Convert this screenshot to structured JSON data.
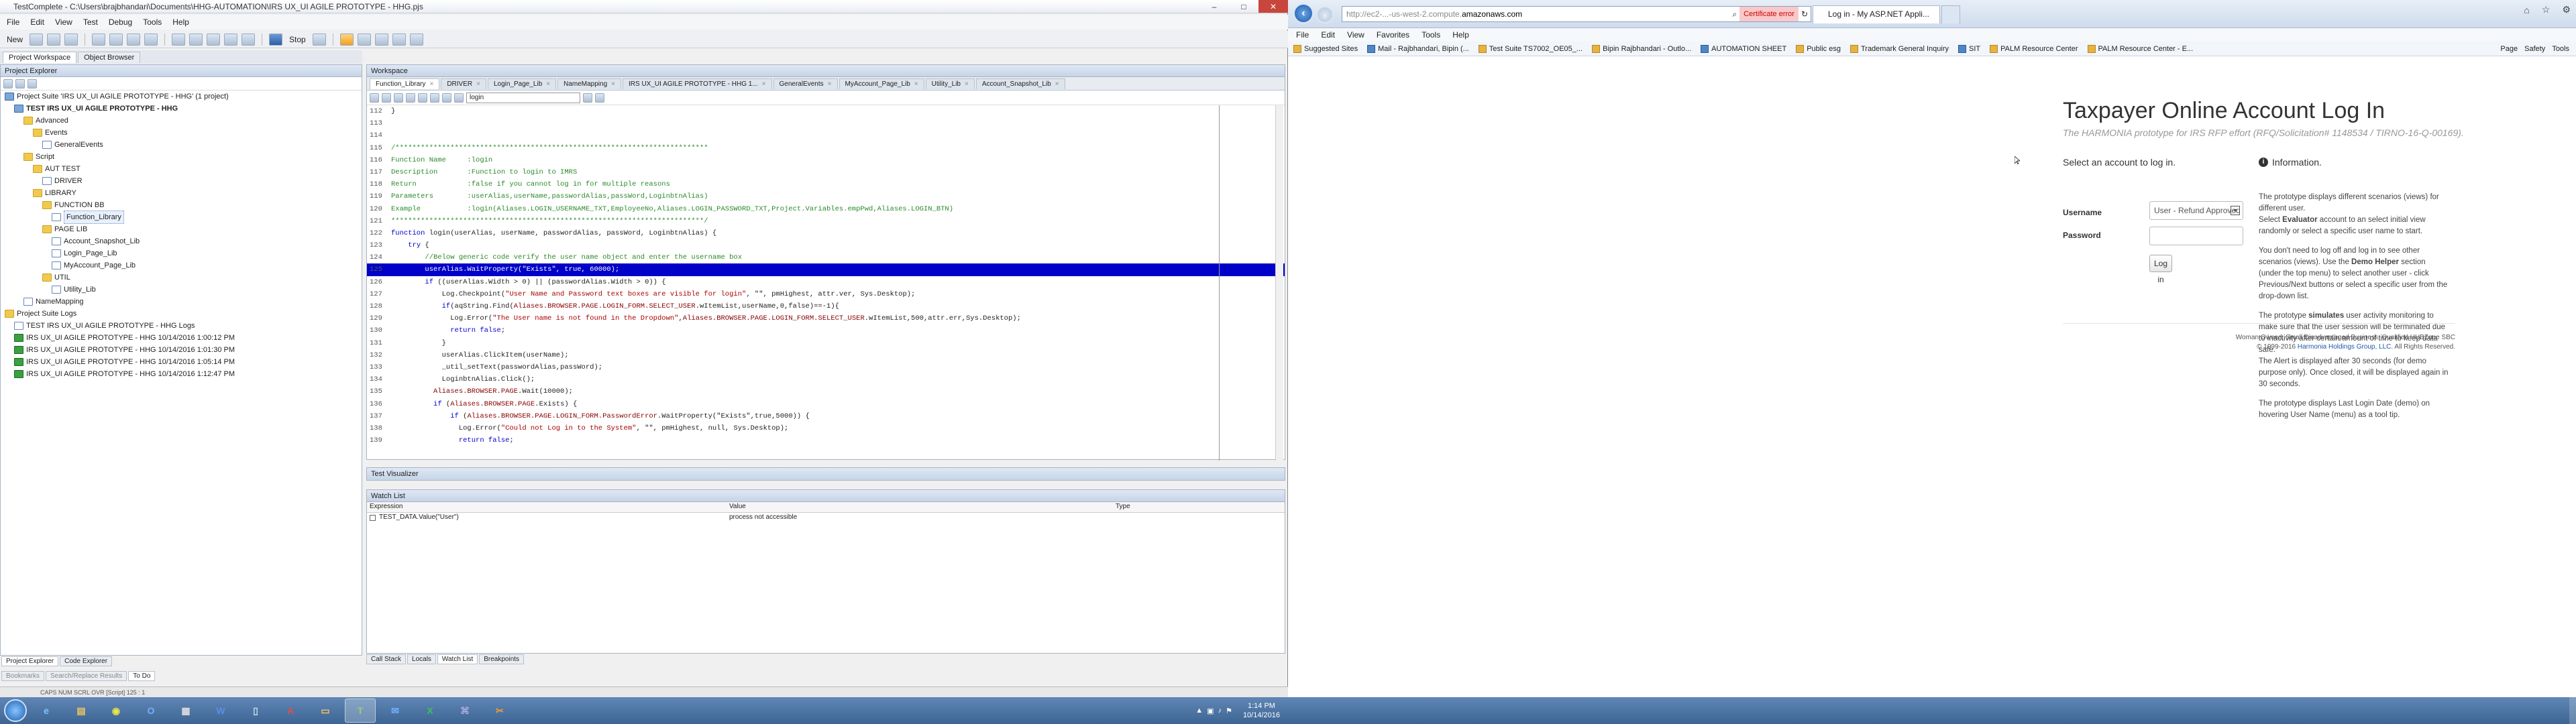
{
  "testcomplete": {
    "title": "TestComplete - C:\\Users\\brajbhandari\\Documents\\HHG-AUTOMATION\\IRS UX_UI AGILE PROTOTYPE - HHG.pjs",
    "window_controls": [
      "–",
      "□",
      "✕"
    ],
    "menu": [
      "File",
      "Edit",
      "View",
      "Test",
      "Debug",
      "Tools",
      "Help"
    ],
    "toolbar": {
      "new_label": "New",
      "stop_label": "Stop"
    },
    "left_tabs": [
      "Project Workspace",
      "Object Browser"
    ],
    "project_explorer": {
      "title": "Project Explorer",
      "items": [
        {
          "indent": 0,
          "icon": "proj",
          "label": "Project Suite 'IRS UX_UI AGILE PROTOTYPE - HHG' (1 project)"
        },
        {
          "indent": 1,
          "icon": "proj",
          "label": "TEST IRS UX_UI AGILE PROTOTYPE - HHG",
          "bold": true
        },
        {
          "indent": 2,
          "icon": "folder",
          "label": "Advanced"
        },
        {
          "indent": 3,
          "icon": "folder",
          "label": "Events"
        },
        {
          "indent": 4,
          "icon": "file",
          "label": "GeneralEvents"
        },
        {
          "indent": 2,
          "icon": "folder",
          "label": "Script"
        },
        {
          "indent": 3,
          "icon": "folder",
          "label": "AUT TEST"
        },
        {
          "indent": 4,
          "icon": "file",
          "label": "DRIVER"
        },
        {
          "indent": 3,
          "icon": "folder",
          "label": "LIBRARY"
        },
        {
          "indent": 4,
          "icon": "folder",
          "label": "FUNCTION BB"
        },
        {
          "indent": 5,
          "icon": "file",
          "label": "Function_Library",
          "selected": true
        },
        {
          "indent": 4,
          "icon": "folder",
          "label": "PAGE LIB"
        },
        {
          "indent": 5,
          "icon": "file",
          "label": "Account_Snapshot_Lib"
        },
        {
          "indent": 5,
          "icon": "file",
          "label": "Login_Page_Lib"
        },
        {
          "indent": 5,
          "icon": "file",
          "label": "MyAccount_Page_Lib"
        },
        {
          "indent": 4,
          "icon": "folder",
          "label": "UTIL"
        },
        {
          "indent": 5,
          "icon": "file",
          "label": "Utility_Lib"
        },
        {
          "indent": 2,
          "icon": "file",
          "label": "NameMapping"
        },
        {
          "indent": 0,
          "icon": "folder",
          "label": "Project Suite Logs"
        },
        {
          "indent": 1,
          "icon": "file",
          "label": "TEST IRS UX_UI AGILE PROTOTYPE - HHG Logs"
        },
        {
          "indent": 1,
          "icon": "ok",
          "label": "IRS UX_UI AGILE PROTOTYPE - HHG 10/14/2016 1:00:12 PM"
        },
        {
          "indent": 1,
          "icon": "ok",
          "label": "IRS UX_UI AGILE PROTOTYPE - HHG 10/14/2016 1:01:30 PM"
        },
        {
          "indent": 1,
          "icon": "ok",
          "label": "IRS UX_UI AGILE PROTOTYPE - HHG 10/14/2016 1:05:14 PM"
        },
        {
          "indent": 1,
          "icon": "ok",
          "label": "IRS UX_UI AGILE PROTOTYPE - HHG 10/14/2016 1:12:47 PM"
        }
      ],
      "bottom_tabs": [
        "Project Explorer",
        "Code Explorer"
      ],
      "bottom_tabs2": [
        "Bookmarks",
        "Search/Replace Results",
        "To Do"
      ]
    },
    "workspace": {
      "title": "Workspace",
      "tabs": [
        "Function_Library",
        "DRIVER",
        "Login_Page_Lib",
        "NameMapping",
        "IRS UX_UI AGILE PROTOTYPE - HHG 1...",
        "GeneralEvents",
        "MyAccount_Page_Lib",
        "Utility_Lib",
        "Account_Snapshot_Lib"
      ],
      "routine_combo": "login",
      "code_lines": [
        {
          "n": "112",
          "segs": [
            [
              "",
              "}"
            ]
          ]
        },
        {
          "n": "113",
          "segs": [
            [
              "",
              ""
            ]
          ]
        },
        {
          "n": "114",
          "segs": [
            [
              "",
              ""
            ]
          ]
        },
        {
          "n": "115",
          "segs": [
            [
              "cm",
              "/**************************************************************************"
            ]
          ]
        },
        {
          "n": "116",
          "segs": [
            [
              "cm",
              "Function Name     :login"
            ]
          ]
        },
        {
          "n": "117",
          "segs": [
            [
              "cm",
              "Description       :Function to login to IMRS"
            ]
          ]
        },
        {
          "n": "118",
          "segs": [
            [
              "cm",
              "Return            :false if you cannot log in for multiple reasons"
            ]
          ]
        },
        {
          "n": "119",
          "segs": [
            [
              "cm",
              "Parameters        :userAlias,userName,passwordAlias,passWord,LoginbtnAlias)"
            ]
          ]
        },
        {
          "n": "120",
          "segs": [
            [
              "cm",
              "Example           :login(Aliases.LOGIN_USERNAME_TXT,EmployeeNo,Aliases.LOGIN_PASSWORD_TXT,Project.Variables.empPwd,Aliases.LOGIN_BTN)"
            ]
          ]
        },
        {
          "n": "121",
          "segs": [
            [
              "cm",
              "**************************************************************************/"
            ]
          ]
        },
        {
          "n": "122",
          "segs": [
            [
              "kw",
              "function"
            ],
            [
              "",
              " login(userAlias, userName, passwordAlias, passWord, LoginbtnAlias) {"
            ]
          ]
        },
        {
          "n": "123",
          "segs": [
            [
              "",
              "    "
            ],
            [
              "kw",
              "try"
            ],
            [
              "",
              " {"
            ]
          ]
        },
        {
          "n": "124",
          "segs": [
            [
              "",
              "        "
            ],
            [
              "cm",
              "//Below generic code verify the user name object and enter the username box"
            ]
          ]
        },
        {
          "n": "125",
          "hl": true,
          "segs": [
            [
              "",
              "        userAlias.WaitProperty(\"Exists\", true, 60000);"
            ]
          ]
        },
        {
          "n": "126",
          "segs": [
            [
              "",
              "        "
            ],
            [
              "kw",
              "if"
            ],
            [
              "",
              " ((userAlias.Width > 0) || (passwordAlias.Width > 0)) {"
            ]
          ]
        },
        {
          "n": "127",
          "segs": [
            [
              "",
              "            Log.Checkpoint("
            ],
            [
              "str",
              "\"User Name and Password text boxes are visible for login\""
            ],
            [
              "",
              ", \"\", pmHighest, attr.ver, Sys.Desktop);"
            ]
          ]
        },
        {
          "n": "128",
          "segs": [
            [
              "",
              "            "
            ],
            [
              "kw",
              "if"
            ],
            [
              "",
              "(aqString.Find("
            ],
            [
              "obj",
              "Aliases.BROWSER.PAGE.LOGIN_FORM.SELECT_USER"
            ],
            [
              "",
              ".wItemList,userName,0,false)==-1){"
            ]
          ]
        },
        {
          "n": "129",
          "segs": [
            [
              "",
              "              Log.Error("
            ],
            [
              "str",
              "\"The User name is not found in the Dropdown\""
            ],
            [
              "",
              ","
            ],
            [
              "obj",
              "Aliases.BROWSER.PAGE.LOGIN_FORM.SELECT_USER"
            ],
            [
              "",
              ".wItemList,500,attr.err,Sys.Desktop);"
            ]
          ]
        },
        {
          "n": "130",
          "segs": [
            [
              "",
              "              "
            ],
            [
              "kw",
              "return false"
            ],
            [
              "",
              ";"
            ]
          ]
        },
        {
          "n": "131",
          "segs": [
            [
              "",
              "            }"
            ]
          ]
        },
        {
          "n": "132",
          "segs": [
            [
              "",
              "            userAlias.ClickItem(userName);"
            ]
          ]
        },
        {
          "n": "133",
          "segs": [
            [
              "",
              "            _util_setText(passwordAlias,passWord);"
            ]
          ]
        },
        {
          "n": "134",
          "segs": [
            [
              "",
              "            LoginbtnAlias.Click();"
            ]
          ]
        },
        {
          "n": "135",
          "segs": [
            [
              "",
              "          "
            ],
            [
              "obj",
              "Aliases.BROWSER.PAGE"
            ],
            [
              "",
              ".Wait(10000);"
            ]
          ]
        },
        {
          "n": "136",
          "segs": [
            [
              "",
              "          "
            ],
            [
              "kw",
              "if"
            ],
            [
              "",
              " ("
            ],
            [
              "obj",
              "Aliases.BROWSER.PAGE"
            ],
            [
              "",
              ".Exists) {"
            ]
          ]
        },
        {
          "n": "137",
          "segs": [
            [
              "",
              "              "
            ],
            [
              "kw",
              "if"
            ],
            [
              "",
              " ("
            ],
            [
              "obj",
              "Aliases.BROWSER.PAGE.LOGIN_FORM.PasswordError"
            ],
            [
              "",
              ".WaitProperty(\"Exists\",true,5000)) {"
            ]
          ]
        },
        {
          "n": "138",
          "segs": [
            [
              "",
              "                Log.Error("
            ],
            [
              "str",
              "\"Could not Log in to the System\""
            ],
            [
              "",
              ", \"\", pmHighest, null, Sys.Desktop);"
            ]
          ]
        },
        {
          "n": "139",
          "segs": [
            [
              "",
              "                "
            ],
            [
              "kw",
              "return false"
            ],
            [
              "",
              ";"
            ]
          ]
        }
      ]
    },
    "test_visualizer": "Test Visualizer",
    "watch_list": {
      "title": "Watch List",
      "columns": [
        "Expression",
        "Value",
        "Type"
      ],
      "rows": [
        {
          "expression": "TEST_DATA.Value(\"User\")",
          "value": "process not accessible",
          "type": ""
        }
      ]
    },
    "ws_bottom_tabs": [
      "Call Stack",
      "Locals",
      "Watch List",
      "Breakpoints"
    ],
    "status_bar": "CAPS  NUM  SCRL  OVR  [Script]  125 : 1"
  },
  "taskbar_left": {
    "apps": [
      "IE",
      "Explorer",
      "Chrome",
      "Outlook",
      "Calculator",
      "Word",
      "Notepad",
      "Acrobat",
      "Folder",
      "TestComplete",
      "Outlook Mail",
      "Excel",
      "Network",
      "Snip"
    ],
    "clock_time": "1:14 PM",
    "clock_date": "10/14/2016"
  },
  "ie": {
    "address_domain": "amazonaws.com",
    "address_prefix": "http://ec2-...-us-west-2.compute.",
    "cert_error": "Certificate error",
    "tab_title": "Log in - My ASP.NET Appli...",
    "menu": [
      "File",
      "Edit",
      "View",
      "Favorites",
      "Tools",
      "Help"
    ],
    "favorites": [
      "Suggested Sites",
      "Mail - Rajbhandari, Bipin (...",
      "Test Suite TS7002_OE05_...",
      "Bipin Rajbhandari - Outlo...",
      "AUTOMATION SHEET",
      "Public esg",
      "Trademark General Inquiry",
      "SIT",
      "PALM Resource Center",
      "PALM Resource Center - E..."
    ],
    "commands": [
      "Page",
      "Safety",
      "Tools"
    ]
  },
  "login_page": {
    "title": "Taxpayer Online Account Log In",
    "subtitle": "The HARMONIA prototype for IRS RFP effort (RFQ/Solicitation# 1148534 / TIRNO-16-Q-00169).",
    "select_account": "Select an account to log in.",
    "username_label": "Username",
    "username_value": "User - Refund Approved",
    "password_label": "Password",
    "login_button": "Log in",
    "info_title": "Information.",
    "info_p1a": "The prototype displays different scenarios (views) for different user.",
    "info_p1b": "Select ",
    "info_p1_bold": "Evaluator",
    "info_p1c": " account to an select initial view randomly or select a specific user name to start.",
    "info_p2a": "You don't need to log off and log in to see other scenarios (views). Use the ",
    "info_p2_bold": "Demo Helper",
    "info_p2b": " section (under the top menu) to select another user - click Previous/Next buttons or select a specific user from the drop-down list.",
    "info_p3a": "The prototype ",
    "info_p3_bold": "simulates",
    "info_p3b": " user activity monitoring to make sure that the user session will be terminated due to inactivity after certain amount of time to keep data safe.",
    "info_p3c": "The Alert is displayed after 30 seconds (for demo purpose only). Once closed, it will be displayed again in 30 seconds.",
    "info_p4": "The prototype displays Last Login Date (demo) on hovering User Name (menu) as a tool tip.",
    "footer1": "Woman Owned, Small Disadvantaged Business, Qualified HUBZone SBC",
    "footer2_prefix": "© 1999-2016 ",
    "footer2_link": "Harmonia Holdings Group, LLC",
    "footer2_suffix": ". All Rights Reserved."
  },
  "colors": {
    "code_highlight": "#0000c8",
    "comment": "#2a8a2a",
    "keyword": "#0000cc",
    "link": "#1f57a8",
    "taskbar": "#4a72a4"
  }
}
